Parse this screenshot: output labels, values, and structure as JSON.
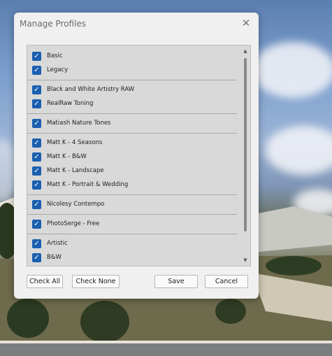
{
  "dialog": {
    "title": "Manage Profiles",
    "close_icon": "close-icon"
  },
  "profile_groups": [
    {
      "items": [
        {
          "label": "Basic",
          "checked": true
        },
        {
          "label": "Legacy",
          "checked": true
        }
      ]
    },
    {
      "items": [
        {
          "label": "Black and White Artistry RAW",
          "checked": true
        },
        {
          "label": "RealRaw Toning",
          "checked": true
        }
      ]
    },
    {
      "items": [
        {
          "label": "Matiash Nature Tones",
          "checked": true
        }
      ]
    },
    {
      "items": [
        {
          "label": "Matt K - 4 Seasons",
          "checked": true
        },
        {
          "label": "Matt K - B&W",
          "checked": true
        },
        {
          "label": "Matt K - Landscape",
          "checked": true
        },
        {
          "label": "Matt K - Portrait & Wedding",
          "checked": true
        }
      ]
    },
    {
      "items": [
        {
          "label": "Nicolesy Contempo",
          "checked": true
        }
      ]
    },
    {
      "items": [
        {
          "label": "PhotoSerge - Free",
          "checked": true
        }
      ]
    },
    {
      "items": [
        {
          "label": "Artistic",
          "checked": true
        },
        {
          "label": "B&W",
          "checked": true
        }
      ]
    }
  ],
  "buttons": {
    "check_all": "Check All",
    "check_none": "Check None",
    "save": "Save",
    "cancel": "Cancel"
  },
  "colors": {
    "checkbox": "#1a5fb0",
    "dialog_bg": "#f0f0f0",
    "list_bg": "#d9d9d9"
  }
}
